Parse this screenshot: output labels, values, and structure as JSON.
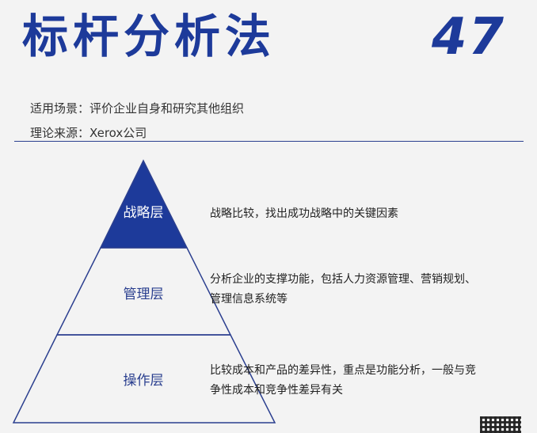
{
  "header": {
    "title": "标杆分析法",
    "page_number": "47"
  },
  "meta": {
    "scenario": "适用场景：评价企业自身和研究其他组织",
    "source": "理论来源：Xerox公司"
  },
  "pyramid": {
    "layers": [
      {
        "label": "战略层",
        "description": "战略比较，找出成功战略中的关键因素"
      },
      {
        "label": "管理层",
        "description": "分析企业的支撑功能，包括人力资源管理、营销规划、管理信息系统等"
      },
      {
        "label": "操作层",
        "description": "比较成本和产品的差异性，重点是功能分析，一般与竞争性成本和竞争性差异有关"
      }
    ]
  },
  "colors": {
    "accent": "#1d3a9a",
    "line": "#2b3f8f",
    "background": "#f3f3f3"
  },
  "icons": {
    "qr": "qr-code-icon"
  }
}
